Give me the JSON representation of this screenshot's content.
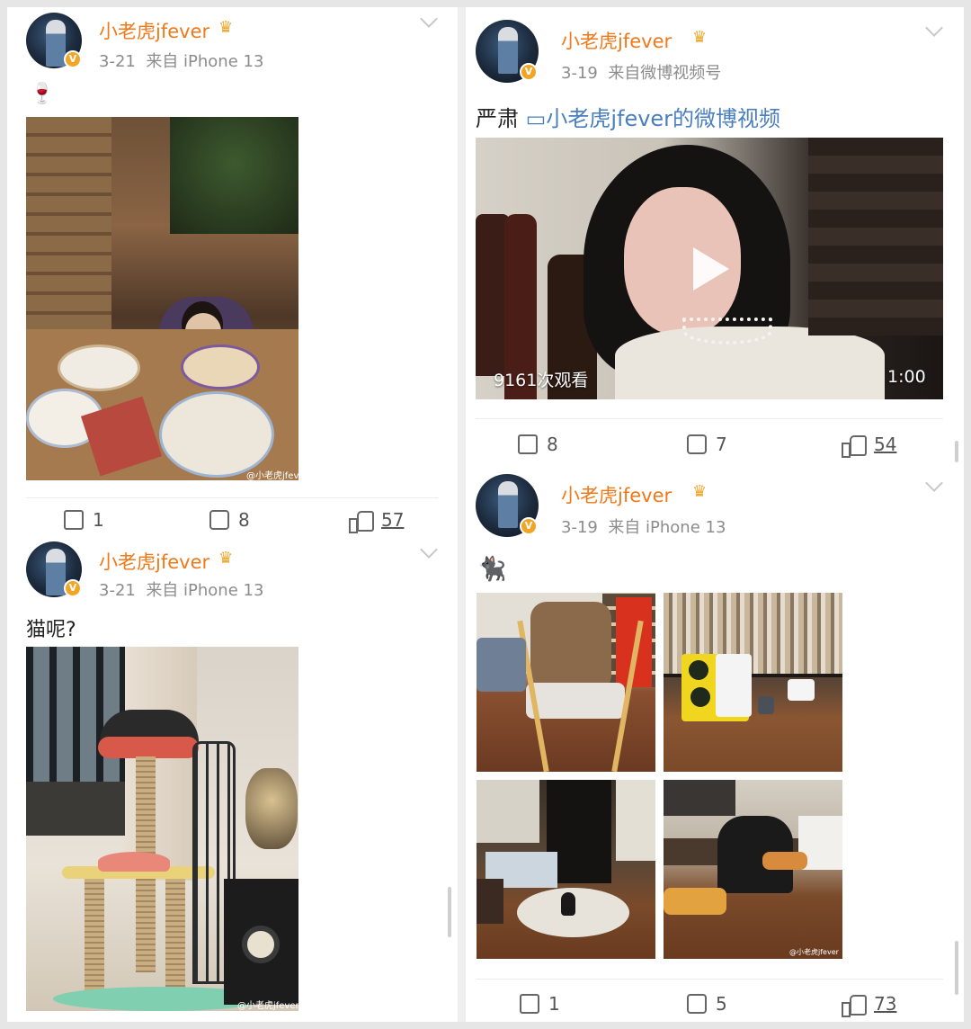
{
  "posts": [
    {
      "username": "小老虎jfever",
      "crown_icon": "crown-icon",
      "date": "3-21",
      "source": "来自 iPhone 13",
      "text": "🍷",
      "actions": {
        "repost": "1",
        "comment": "8",
        "like": "57"
      }
    },
    {
      "username": "小老虎jfever",
      "date": "3-21",
      "source": "来自 iPhone 13",
      "text": "猫呢?",
      "watermark": "@小老虎jfever"
    },
    {
      "username": "小老虎jfever",
      "date": "3-19",
      "source": "来自微博视频号",
      "text": "严肃",
      "video_link": "小老虎jfever的微博视频",
      "video": {
        "views": "9161次观看",
        "duration": "1:00"
      },
      "actions": {
        "repost": "8",
        "comment": "7",
        "like": "54"
      }
    },
    {
      "username": "小老虎jfever",
      "date": "3-19",
      "source": "来自 iPhone 13",
      "text": "🐈‍⬛",
      "actions": {
        "repost": "1",
        "comment": "5",
        "like": "73"
      }
    }
  ],
  "watermark": "@小老虎jfever",
  "colors": {
    "username": "#f0791a",
    "badge": "#f2a524",
    "link": "#4a7fbf",
    "meta": "#8c8c8c"
  }
}
